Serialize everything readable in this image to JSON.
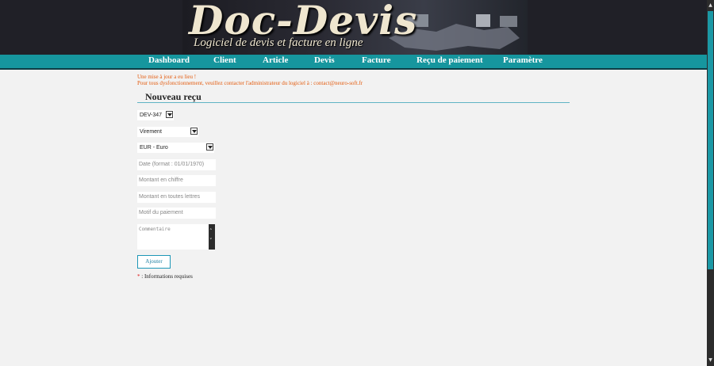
{
  "header": {
    "logo_title": "Doc-Devis",
    "logo_subtitle": "Logiciel de devis et facture en ligne"
  },
  "nav": {
    "items": [
      {
        "label": "Dashboard"
      },
      {
        "label": "Client"
      },
      {
        "label": "Article"
      },
      {
        "label": "Devis"
      },
      {
        "label": "Facture"
      },
      {
        "label": "Reçu de paiement"
      },
      {
        "label": "Paramètre"
      }
    ]
  },
  "notice": {
    "line1": "Une mise à jour a eu lieu !",
    "line2": "Pour tous dysfonctionnement, veuillez contacter l'administrateur du logiciel à : contact@neuro-soft.fr"
  },
  "form": {
    "title": "Nouveau reçu",
    "devis_select": "DEV-347",
    "payment_method_select": "Virement",
    "currency_select": "EUR - Euro",
    "date_placeholder": "Date (format : 01/01/1970)",
    "amount_figures_placeholder": "Montant en chiffre",
    "amount_words_placeholder": "Montant en toutes lettres",
    "reason_placeholder": "Motif du paiement",
    "comment_placeholder": "Commentaire",
    "submit_label": "Ajouter",
    "required_star": "*",
    "required_note": " : Informations requises"
  },
  "colors": {
    "nav_bg": "#16969e",
    "accent": "#1e97b7",
    "notice_text": "#e35b0e",
    "banner_bg": "#202027"
  }
}
